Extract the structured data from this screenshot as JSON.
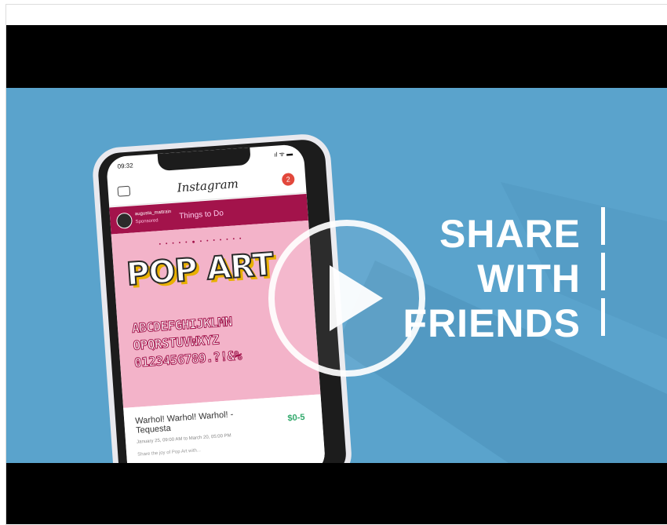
{
  "phone": {
    "status_time": "09:32",
    "status_icons": "ıl ᯤ ▬",
    "app_logo": "Instagram",
    "notification_count": "2",
    "ad": {
      "username": "augusta_mattrain",
      "sponsored": "Sponsored",
      "cta": "Things to Do"
    },
    "art": {
      "carousel_dots": "• • • • • ● • • • • • • •",
      "title": "POP ART",
      "alphabet_rows": [
        "ABCDEFGHIJKLMN",
        "OPQRSTUVWXYZ",
        "0123456789.?!&%"
      ]
    },
    "event": {
      "title": "Warhol! Warhol! Warhol! - Tequesta",
      "price": "$0-5",
      "date": "January 25, 09:00 AM to March 20, 05:00 PM",
      "description": "Share the joy of Pop Art with..."
    }
  },
  "headline": {
    "lines": [
      "SHARE",
      "WITH",
      "FRIENDS"
    ]
  },
  "colors": {
    "background": "#5aa3cc",
    "ad_bar": "#a3134b",
    "art_bg": "#f3b3c9",
    "price": "#2fa86a"
  },
  "icons": {
    "play": "play-icon",
    "camera": "camera-icon",
    "badge": "notification-badge"
  }
}
